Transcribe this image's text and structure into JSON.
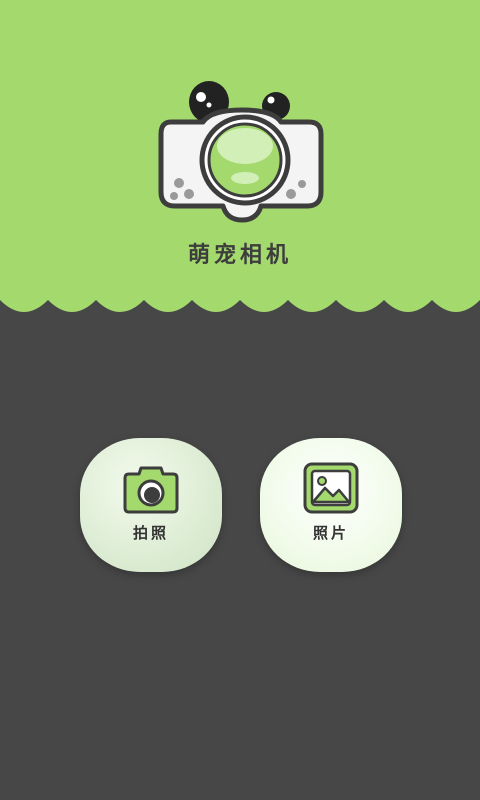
{
  "app": {
    "title": "萌宠相机"
  },
  "actions": {
    "camera_label": "拍照",
    "photos_label": "照片"
  },
  "colors": {
    "header_green": "#a3d96d",
    "background": "#474747",
    "icon_green": "#a3d96d",
    "icon_outline": "#3d3d3d"
  },
  "icons": {
    "logo": "panda-camera-logo",
    "camera": "camera-icon",
    "photos": "picture-icon"
  }
}
